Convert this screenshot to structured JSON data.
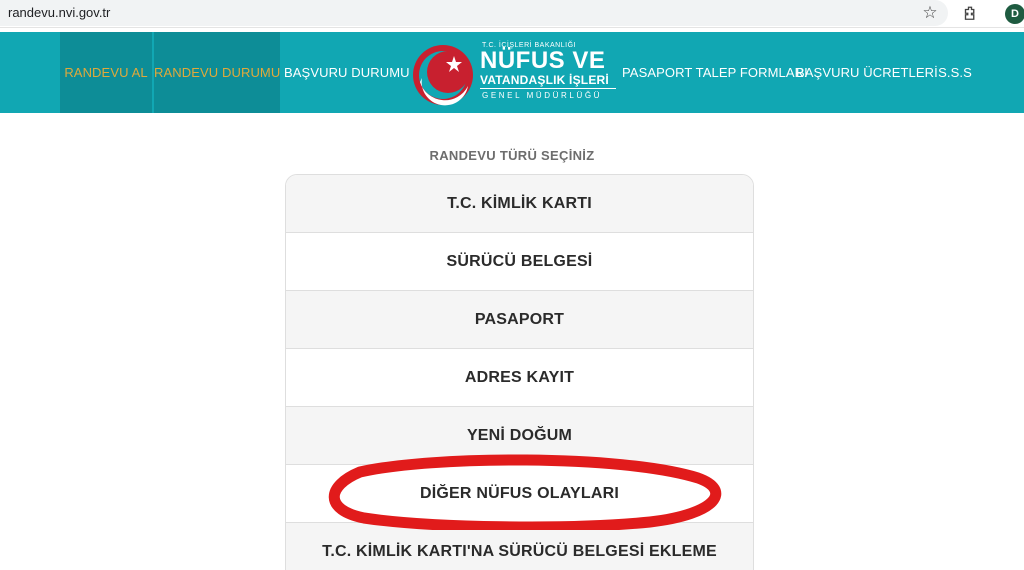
{
  "browser": {
    "url": "randevu.nvi.gov.tr",
    "avatar_letter": "D"
  },
  "nav": {
    "randevu_al": "RANDEVU AL",
    "randevu_durumu": "RANDEVU DURUMU",
    "basvuru_durumu": "BAŞVURU DURUMU",
    "pasaport_talep": "PASAPORT TALEP FORMLARI",
    "basvuru_ucretleri": "BAŞVURU ÜCRETLERİ",
    "sss": "S.S.S"
  },
  "logo": {
    "ministry": "T.C. İÇİŞLERİ BAKANLIĞI",
    "name_line1": "NÜFUS VE",
    "name_line2": "VATANDAŞLIK İŞLERİ",
    "subtitle": "GENEL MÜDÜRLÜĞÜ"
  },
  "main": {
    "title": "RANDEVU TÜRÜ SEÇİNİZ",
    "types": [
      "T.C. KİMLİK KARTI",
      "SÜRÜCÜ BELGESİ",
      "PASAPORT",
      "ADRES KAYIT",
      "YENİ DOĞUM",
      "DİĞER NÜFUS OLAYLARI",
      "T.C. KİMLİK KARTI'NA SÜRÜCÜ BELGESİ EKLEME"
    ]
  },
  "colors": {
    "header": "#11a7b3",
    "active_nav_bg": "#0d8d97",
    "active_nav_text": "#e0a93b",
    "annotation": "#e11b1b"
  }
}
